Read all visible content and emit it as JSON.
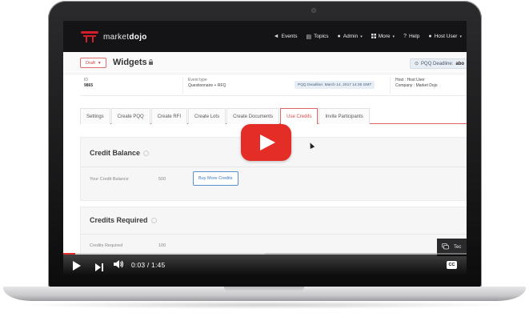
{
  "header": {
    "logo_text_1": "market",
    "logo_text_2": "dojo",
    "nav": [
      {
        "icon": "megaphone-icon",
        "glyph": "◄",
        "label": "Events"
      },
      {
        "icon": "document-icon",
        "glyph": "▤",
        "label": "Topics"
      },
      {
        "icon": "person-icon",
        "glyph": "●",
        "label": "Admin",
        "caret": "▾"
      },
      {
        "icon": "grid-icon",
        "glyph": "",
        "label": "More",
        "caret": "▾"
      },
      {
        "icon": "help-icon",
        "glyph": "?",
        "label": "Help"
      },
      {
        "icon": "user-icon",
        "glyph": "●",
        "label": "Host User",
        "caret": "▾"
      }
    ]
  },
  "titlebar": {
    "status": "Draft",
    "status_caret": "▾",
    "title": "Widgets",
    "lock_glyph": "🔒",
    "deadline_prefix": "PQQ Deadline:",
    "deadline_value": "abo"
  },
  "info": {
    "id_label": "ID",
    "id_value": "9865",
    "event_type_label": "Event type",
    "event_type_value": "Questionnaire + RFQ",
    "pqq_deadline": "PQQ Deadline: March 14, 2017 14:35 GMT",
    "host_label": "Host : Host User",
    "company_label": "Company : Market Dojo"
  },
  "tabs": [
    {
      "label": "Settings",
      "active": false
    },
    {
      "label": "Create PQQ",
      "active": false
    },
    {
      "label": "Create RFI",
      "active": false
    },
    {
      "label": "Create Lots",
      "active": false
    },
    {
      "label": "Create Documents",
      "active": false
    },
    {
      "label": "Use Credits",
      "active": true
    },
    {
      "label": "Invite Participants",
      "active": false
    }
  ],
  "credit_balance": {
    "title": "Credit Balance",
    "field_label": "Your Credit Balance",
    "field_value": "500",
    "button_label": "Buy More Credits"
  },
  "credits_required": {
    "title": "Credits Required",
    "field_label": "Credits Required",
    "field_value": "100"
  },
  "chat": {
    "label": "Tec"
  },
  "video": {
    "time": "0:03 / 1:45",
    "cc_label": "CC",
    "played_fraction": 0.03,
    "buffered_fraction": 0.5
  },
  "colors": {
    "accent_red": "#e52d27",
    "header_bg": "#141416",
    "link_blue": "#3d78c2"
  }
}
